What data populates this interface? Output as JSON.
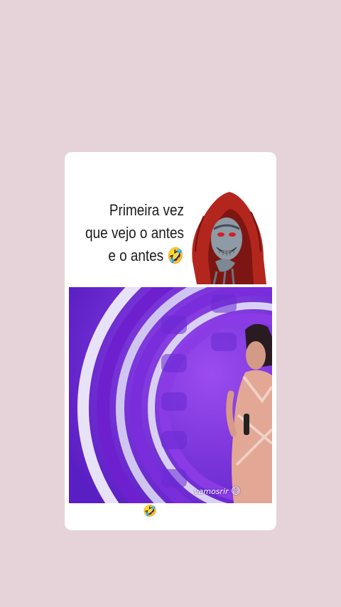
{
  "caption": {
    "line1": "Primeira vez",
    "line2": "que vejo o antes",
    "line3": "e o antes",
    "emoji": "🤣"
  },
  "video": {
    "watermark": "vamosrir",
    "watermark_emoji": "😅"
  },
  "footer": {
    "emoji": "🤣"
  },
  "colors": {
    "background": "#e6d2d9",
    "card": "#ffffff",
    "video_purple": "#6c2bd6"
  },
  "icons": {
    "reaction": "rolling-on-floor-laughing-emoji",
    "watermark_face": "grinning-sweat-emoji"
  }
}
